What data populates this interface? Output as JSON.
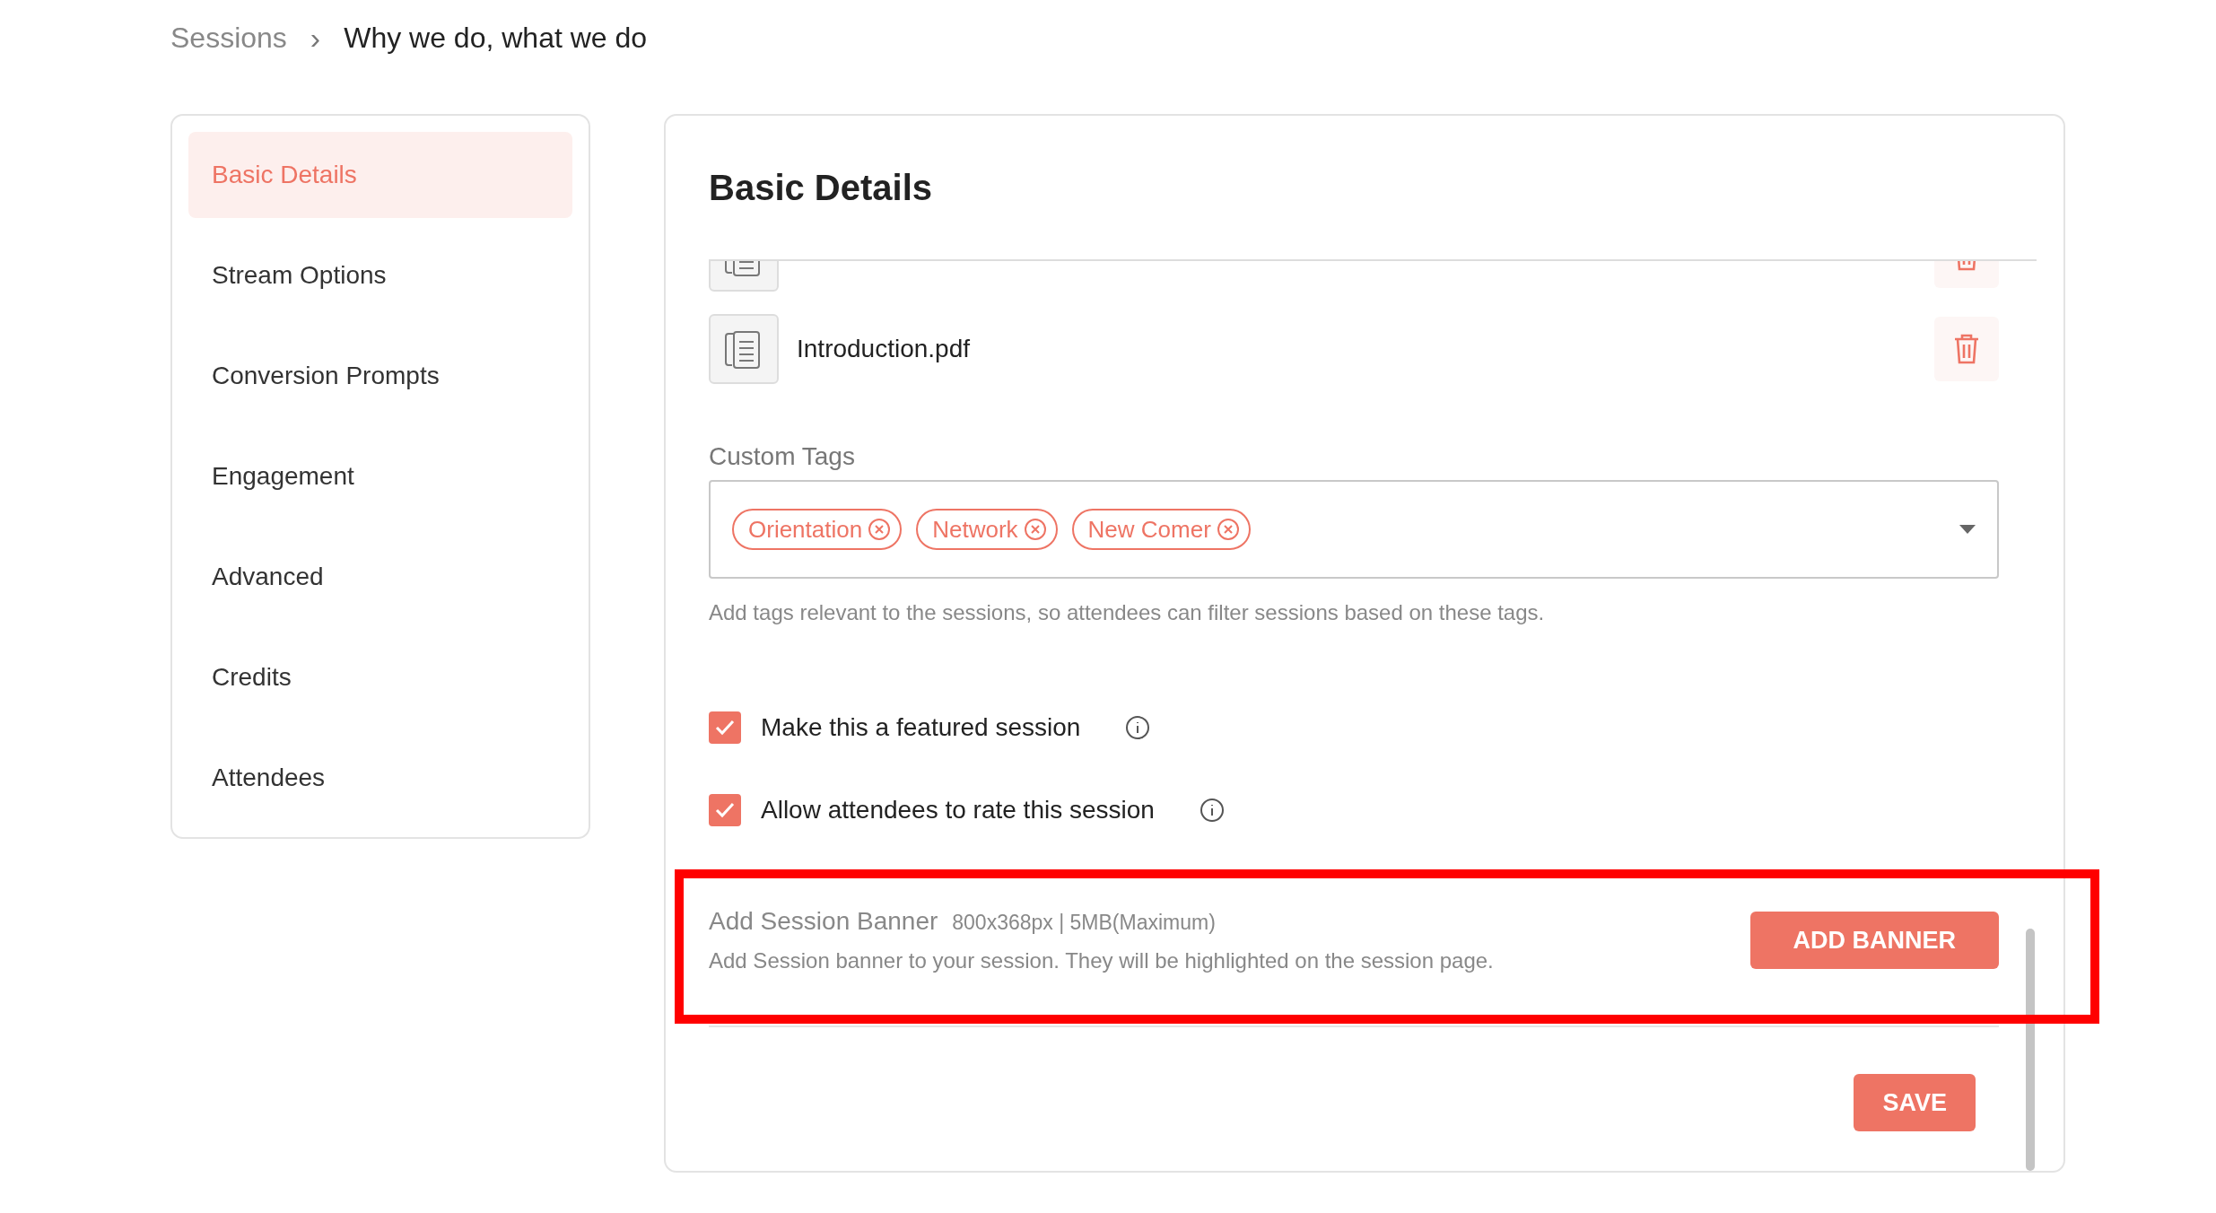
{
  "breadcrumb": {
    "parent": "Sessions",
    "separator": "›",
    "current": "Why we do, what we do"
  },
  "sidebar": {
    "items": [
      {
        "label": "Basic Details",
        "selected": true
      },
      {
        "label": "Stream Options",
        "selected": false
      },
      {
        "label": "Conversion Prompts",
        "selected": false
      },
      {
        "label": "Engagement",
        "selected": false
      },
      {
        "label": "Advanced",
        "selected": false
      },
      {
        "label": "Credits",
        "selected": false
      },
      {
        "label": "Attendees",
        "selected": false
      }
    ]
  },
  "panel": {
    "title": "Basic Details",
    "files": [
      {
        "kind": "cut"
      },
      {
        "kind": "full",
        "name": "Introduction.pdf"
      }
    ],
    "custom_tags": {
      "label": "Custom Tags",
      "tags": [
        "Orientation",
        "Network",
        "New Comer"
      ],
      "hint": "Add tags relevant to the sessions, so attendees can filter sessions based on these tags."
    },
    "options": [
      {
        "label": "Make this a featured session",
        "checked": true
      },
      {
        "label": "Allow attendees to rate this session",
        "checked": true
      }
    ],
    "banner": {
      "title": "Add Session Banner",
      "spec": "800x368px | 5MB(Maximum)",
      "description": "Add Session banner to your session. They will be highlighted on the session page.",
      "button": "ADD BANNER",
      "highlighted": true
    },
    "save_button": "SAVE"
  }
}
